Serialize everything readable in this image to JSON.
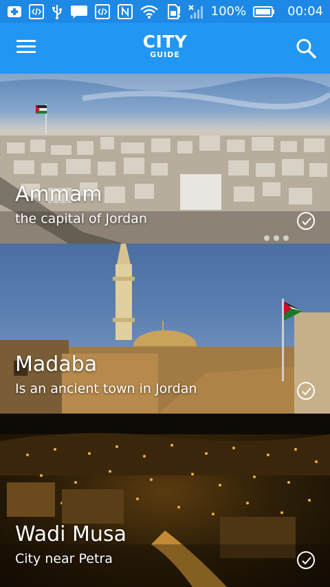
{
  "status_bar": {
    "battery_percent": "100%",
    "time": "00:04"
  },
  "app_bar": {
    "logo_main": "CITY",
    "logo_sub": "GUIDE"
  },
  "cities": [
    {
      "name": "Ammam",
      "subtitle": "the capital of Jordan"
    },
    {
      "name": "Madaba",
      "subtitle": "Is an ancient town in Jordan"
    },
    {
      "name": "Wadi Musa",
      "subtitle": "City near Petra"
    }
  ],
  "colors": {
    "app_bar": "#2196f3",
    "status_bar": "#1e88e5"
  }
}
